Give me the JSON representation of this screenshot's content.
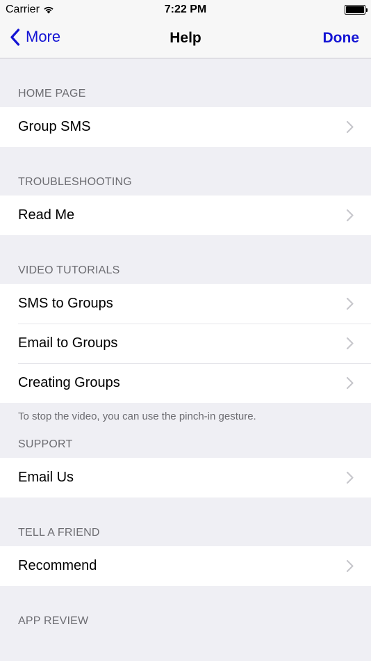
{
  "status_bar": {
    "carrier": "Carrier",
    "time": "7:22 PM",
    "wifi_icon": "wifi-icon",
    "battery_icon": "battery-icon"
  },
  "nav": {
    "back_label": "More",
    "back_icon": "chevron-left-icon",
    "title": "Help",
    "done_label": "Done",
    "accent_color": "#1414d4"
  },
  "sections": {
    "home": {
      "header": "HOME PAGE",
      "items": [
        "Group SMS"
      ]
    },
    "troubleshooting": {
      "header": "TROUBLESHOOTING",
      "items": [
        "Read Me"
      ]
    },
    "video": {
      "header": "VIDEO TUTORIALS",
      "items": [
        "SMS to Groups",
        "Email to Groups",
        "Creating Groups"
      ],
      "footer": "To stop the video, you can use the pinch-in gesture."
    },
    "support": {
      "header": "SUPPORT",
      "items": [
        "Email Us"
      ]
    },
    "tell_friend": {
      "header": "TELL A FRIEND",
      "items": [
        "Recommend"
      ]
    },
    "app_review": {
      "header": "APP REVIEW"
    }
  },
  "colors": {
    "background": "#efeff4",
    "header_text": "#6d6d72",
    "chevron": "#c7c7cc"
  }
}
